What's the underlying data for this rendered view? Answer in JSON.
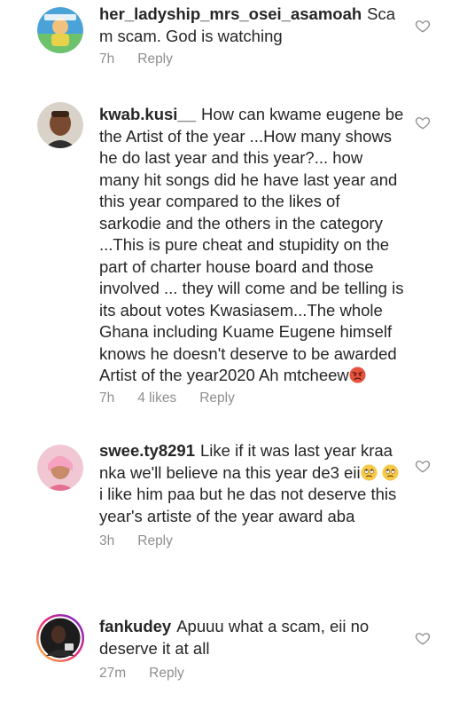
{
  "comments": [
    {
      "username": "her_ladyship_mrs_osei_asamoah",
      "text": "Scam scam. God is watching",
      "time": "7h",
      "likes": "",
      "reply_label": "Reply",
      "avatar": "illustrated-avatar"
    },
    {
      "username": "kwab.kusi__",
      "text": "How can kwame eugene be the Artist of the year ...How many shows he do last year and this year?... how many hit songs did he have last year and this year compared to the likes of sarkodie and the others in the category ...This is pure cheat and stupidity on the part of charter house board and those involved ... they will come and be telling is its about votes Kwasiasem...The whole Ghana including Kuame Eugene himself knows he doesn't deserve to be awarded Artist of the year2020 Ah mtcheew",
      "emoji_after": "angry-face",
      "time": "7h",
      "likes": "4 likes",
      "reply_label": "Reply",
      "avatar": "photo-avatar"
    },
    {
      "username": "swee.ty8291",
      "text_part1": "Like if it was last year kraa nka we'll believe na this year de3 eii",
      "emoji_mid": "eye-roll-face",
      "emoji_mid2": "eye-roll-face",
      "text_part2": "i like him paa but he das not deserve this year's artiste of the year award aba",
      "time": "3h",
      "likes": "",
      "reply_label": "Reply",
      "avatar": "photo-avatar"
    },
    {
      "username": "fankudey",
      "text": "Apuuu what a scam, eii no deserve it at all",
      "time": "27m",
      "likes": "",
      "reply_label": "Reply",
      "avatar": "story-ring-avatar"
    }
  ],
  "colors": {
    "text": "#262626",
    "meta": "#8e8e8e",
    "story_ring_start": "#f9ce34",
    "story_ring_mid": "#ee2a7b",
    "story_ring_end": "#6228d7"
  },
  "icons": {
    "like": "heart-outline-icon"
  }
}
